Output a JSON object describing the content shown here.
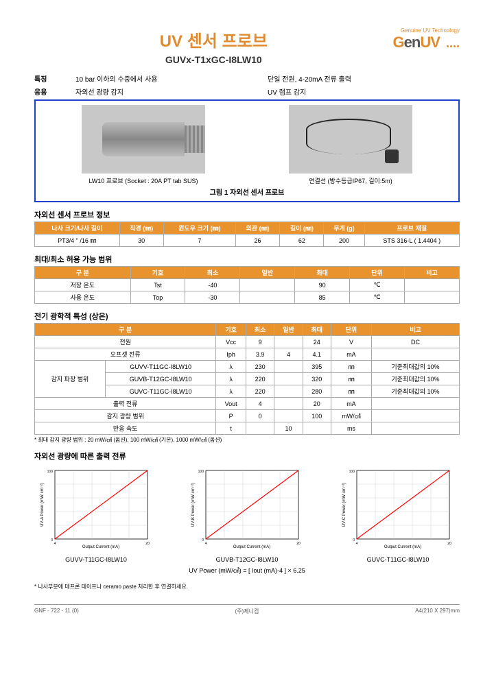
{
  "header": {
    "main_title": "UV 센서 프로브",
    "sub_title": "GUVx-T1xGC-I8LW10",
    "logo_tag": "Genuine UV Technology",
    "logo": {
      "g": "G",
      "en": "en",
      "uv": "UV"
    }
  },
  "features": {
    "label": "특징",
    "col1": "10 bar 이하의 수중에서 사용",
    "col2": "단일 전원, 4-20mA 전류 출력"
  },
  "applications": {
    "label": "응용",
    "col1": "자외선 광량 감지",
    "col2": "UV 램프 감지"
  },
  "figure": {
    "item1": "LW10 프로브 (Socket : 20A PT tab SUS)",
    "item2": "연결선 (방수등급IP67, 길이:5m)",
    "caption": "그림 1 자외선 센서 프로브"
  },
  "table1": {
    "title": "자외선 센서 프로브 정보",
    "headers": [
      "나사 크기/나사 길이",
      "직경 (㎜)",
      "윈도우 크기 (㎜)",
      "외관 (㎜)",
      "길이 (㎜)",
      "무게 (g)",
      "프로브 재질"
    ],
    "row": [
      "PT3/4 \" /16 ㎜",
      "30",
      "7",
      "26",
      "62",
      "200",
      "STS 316-L ( 1.4404 )"
    ]
  },
  "table2": {
    "title": "최대/최소 허용 가능 범위",
    "headers": [
      "구 분",
      "기호",
      "최소",
      "일반",
      "최대",
      "단위",
      "비고"
    ],
    "rows": [
      [
        "저장 온도",
        "Tst",
        "-40",
        "",
        "90",
        "℃",
        ""
      ],
      [
        "사용 온도",
        "Top",
        "-30",
        "",
        "85",
        "℃",
        ""
      ]
    ]
  },
  "table3": {
    "title": "전기 광학적 특성 (상온)",
    "headers": [
      "구 분",
      "기호",
      "최소",
      "일반",
      "최대",
      "단위",
      "비고"
    ],
    "rows": [
      {
        "c0a": "",
        "c0b": "전원",
        "c1": "Vcc",
        "c2": "9",
        "c3": "",
        "c4": "24",
        "c5": "V",
        "c6": "DC"
      },
      {
        "c0a": "",
        "c0b": "오프셋 전류",
        "c1": "Iph",
        "c2": "3.9",
        "c3": "4",
        "c4": "4.1",
        "c5": "mA",
        "c6": ""
      },
      {
        "c0a": "감지 파장 범위",
        "c0b": "GUVV-T11GC-I8LW10",
        "c1": "λ",
        "c2": "230",
        "c3": "",
        "c4": "395",
        "c5": "㎚",
        "c6": "기준최대값의 10%"
      },
      {
        "c0a": "",
        "c0b": "GUVB-T12GC-I8LW10",
        "c1": "λ",
        "c2": "220",
        "c3": "",
        "c4": "320",
        "c5": "㎚",
        "c6": "기준최대값의 10%"
      },
      {
        "c0a": "",
        "c0b": "GUVC-T11GC-I8LW10",
        "c1": "λ",
        "c2": "220",
        "c3": "",
        "c4": "280",
        "c5": "㎚",
        "c6": "기준최대값의 10%"
      },
      {
        "c0a": "",
        "c0b": "출력 전류",
        "c1": "Vout",
        "c2": "4",
        "c3": "",
        "c4": "20",
        "c5": "mA",
        "c6": ""
      },
      {
        "c0a": "",
        "c0b": "감지 광량 범위",
        "c1": "P",
        "c2": "0",
        "c3": "",
        "c4": "100",
        "c5": "mW/㎠",
        "c6": ""
      },
      {
        "c0a": "",
        "c0b": "반응 속도",
        "c1": "t",
        "c2": "",
        "c3": "10",
        "c4": "",
        "c5": "ms",
        "c6": ""
      }
    ],
    "note": "* 최대 감지 광량 범위 : 20 mW/㎠ (옵션), 100 mW/㎠ (기본), 1000 mW/㎠ (옵션)"
  },
  "charts_section": {
    "title": "자외선 광량에 따른 출력 전류",
    "axis_x": "Output Current (mA)",
    "axis_y_a": "UV-A Power (mW·cm⁻²)",
    "axis_y_b": "UV-B Power (mW·cm⁻²)",
    "axis_y_c": "UV-C Power (mW·cm⁻²)",
    "c1": "GUVV-T11GC-I8LW10",
    "c2": "GUVB-T12GC-I8LW10",
    "c3": "GUVC-T11GC-I8LW10",
    "formula": "UV Power (mW/㎠) = [ Iout (mA)-4 ] × 6.25"
  },
  "chart_data": [
    {
      "type": "line",
      "title": "GUVV-T11GC-I8LW10",
      "xlabel": "Output Current (mA)",
      "ylabel": "UV-A Power (mW·cm⁻²)",
      "xlim": [
        4,
        20
      ],
      "ylim": [
        0,
        100
      ],
      "series": [
        {
          "name": "UV Power",
          "x": [
            4,
            20
          ],
          "y": [
            0,
            100
          ]
        }
      ]
    },
    {
      "type": "line",
      "title": "GUVB-T12GC-I8LW10",
      "xlabel": "Output Current (mA)",
      "ylabel": "UV-B Power (mW·cm⁻²)",
      "xlim": [
        4,
        20
      ],
      "ylim": [
        0,
        100
      ],
      "series": [
        {
          "name": "UV Power",
          "x": [
            4,
            20
          ],
          "y": [
            0,
            100
          ]
        }
      ]
    },
    {
      "type": "line",
      "title": "GUVC-T11GC-I8LW10",
      "xlabel": "Output Current (mA)",
      "ylabel": "UV-C Power (mW·cm⁻²)",
      "xlim": [
        4,
        20
      ],
      "ylim": [
        0,
        100
      ],
      "series": [
        {
          "name": "UV Power",
          "x": [
            4,
            20
          ],
          "y": [
            0,
            100
          ]
        }
      ]
    }
  ],
  "footnote": "* 나사부분에 테프론 테이프나 ceramo paste 처리한 후 연결하세요.",
  "footer": {
    "left": "GNF - 722 - 11 (0)",
    "center": "(주)제니컴",
    "right": "A4(210 X 297)mm"
  }
}
